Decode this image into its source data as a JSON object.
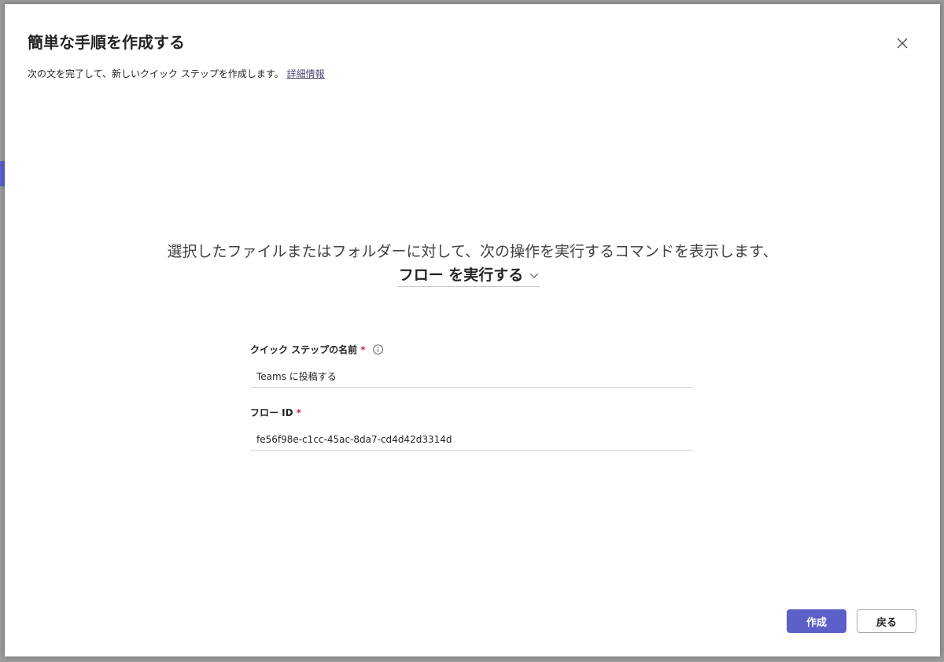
{
  "dialog": {
    "title": "簡単な手順を作成する",
    "subtitle": "次の文を完了して、新しいクイック ステップを作成します。",
    "learn_more_link": "詳細情報",
    "sentence": "選択したファイルまたはフォルダーに対して、次の操作を実行するコマンドを表示します、",
    "action_selected": "フロー を実行する"
  },
  "fields": {
    "name": {
      "label": "クイック ステップの名前",
      "required_marker": "*",
      "value": "Teams に投稿する"
    },
    "flow_id": {
      "label": "フロー ID",
      "required_marker": "*",
      "value": "fe56f98e-c1cc-45ac-8da7-cd4d42d3314d"
    }
  },
  "buttons": {
    "create": "作成",
    "back": "戻る"
  },
  "colors": {
    "accent": "#5b5fc7",
    "required": "#c4314b",
    "link": "#464775"
  },
  "icons": [
    "close-icon",
    "chevron-down-icon",
    "info-icon"
  ]
}
